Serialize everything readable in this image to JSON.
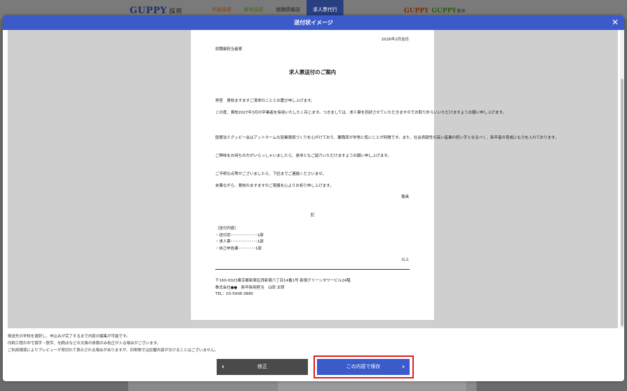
{
  "site": {
    "logo_text": "GUPPY",
    "logo_sub": "採用",
    "nav": [
      "中途採用",
      "新卒採用",
      "就職情報誌",
      "求人票代行"
    ],
    "right_logo_1": "GUPPY",
    "right_logo_2": "GUPPY",
    "right_logo_sub": "新卒"
  },
  "modal": {
    "title": "送付状イメージ",
    "close_symbol": "✕"
  },
  "letter": {
    "date": "2026年2月吉日",
    "recipient": "就職御担当者様",
    "title": "求人票送付のご案内",
    "greeting": "拝啓　貴校ますますご清栄のこととお慶び申し上げます。",
    "para1": "この度、貴校2027年3月の卒業者を採用いたしたく存じます。つきましては、求人票を同封させていただきますのでお取り計らいいただけますようお願い申し上げます。",
    "para2": "医療法人グッピー会はアットホームな就業環境づくりを心がけており、離職率が非常に低いことが特徴です。また、社会貢献性の高い産業の担い手となるべく、新卒者の育成にも力を入れております。",
    "para3": "ご興味をお持ちの方がいらっしゃいましたら、是非ともご紹介いただけますようお願い申し上げます。",
    "para4": "ご不明な点等がございましたら、下記までご連絡くださいませ。",
    "closing": "末筆ながら、貴校のますますのご発展を心よりお祈り申し上げます。",
    "keigu": "敬具",
    "ki": "記",
    "contents": [
      "［送付内容］",
      "・送付状･･････････････1部",
      "・求人票･･････････････1部",
      "・自己申告書･････････1部"
    ],
    "ijou": "以上",
    "sender": [
      "〒160-0023東京都新宿区西新宿六丁目14番1号 新宿グリーンタワービル24階",
      "株式会社●●　新卒採用担当　山田 太郎",
      "TEL：03-5908-3880"
    ]
  },
  "notes": [
    "発送先の学校を選択し、申込みが完了するまで内容の編集が可能です。",
    "印刷工程の中で誤字・脱字、句読点などの文面の体裁のみ校正が入る場合がございます。",
    "ご利用環境によりプレビューが見切れて表示される場合がありますが、印刷物では記載内容が欠けることはございません。"
  ],
  "buttons": {
    "edit_label": "修正",
    "save_label": "この内容で保存"
  },
  "colors": {
    "accent": "#3b5bcb",
    "highlight": "#e41b1b",
    "edit_button": "#4a4a4a"
  }
}
